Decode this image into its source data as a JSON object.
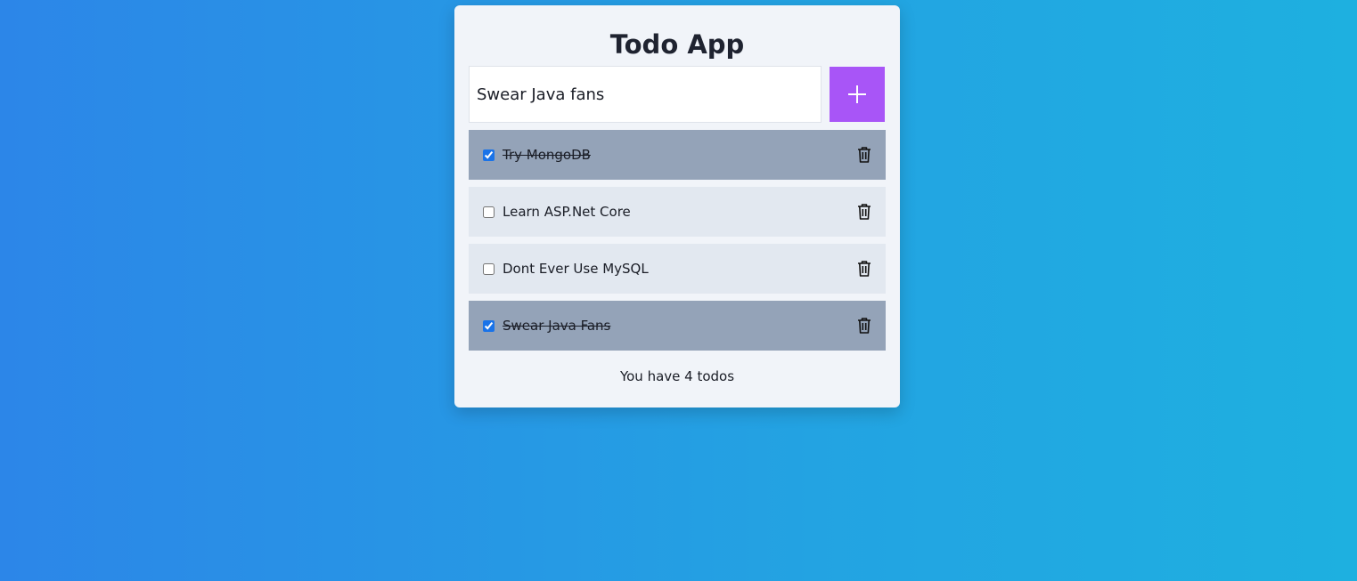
{
  "app": {
    "title": "Todo App"
  },
  "input": {
    "value": "Swear Java fans",
    "add_icon": "plus-icon"
  },
  "todos": [
    {
      "label": "Try MongoDB",
      "done": true
    },
    {
      "label": "Learn ASP.Net Core",
      "done": false
    },
    {
      "label": "Dont Ever Use MySQL",
      "done": false
    },
    {
      "label": "Swear Java Fans",
      "done": true
    }
  ],
  "delete_icon": "trash-icon",
  "footer": {
    "text": "You have 4 todos"
  },
  "colors": {
    "accent": "#a855f7",
    "item_bg": "#e2e8f0",
    "item_done_bg": "#94a3b8",
    "card_bg": "#f1f4f9"
  }
}
